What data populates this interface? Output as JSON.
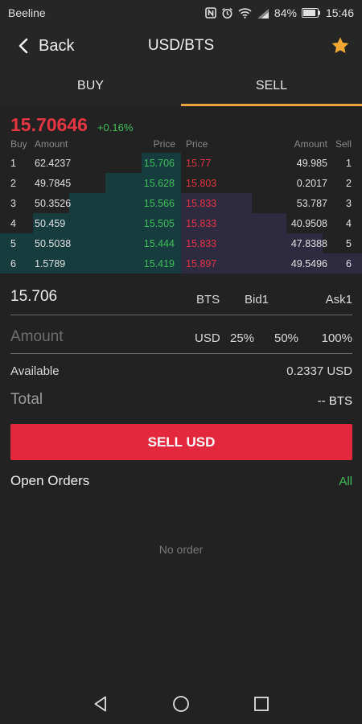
{
  "status_bar": {
    "carrier": "Beeline",
    "battery": "84%",
    "time": "15:46"
  },
  "header": {
    "back_label": "Back",
    "title": "USD/BTS",
    "icons": {
      "back": "chevron-left-icon",
      "favorite": "star-icon"
    },
    "star_color": "#f0a833"
  },
  "tabs": [
    {
      "label": "BUY",
      "active": false
    },
    {
      "label": "SELL",
      "active": true
    }
  ],
  "ticker": {
    "price": "15.70646",
    "change": "+0.16%"
  },
  "order_book": {
    "headers": {
      "buy": "Buy",
      "amount_left": "Amount",
      "price_left": "Price",
      "price_right": "Price",
      "amount_right": "Amount",
      "sell": "Sell"
    },
    "rows": [
      {
        "idx": "1",
        "bid_amount": "62.4237",
        "bid_price": "15.706",
        "ask_price": "15.77",
        "ask_amount": "49.985",
        "ask_idx": "1",
        "bid_depth": 0.22,
        "ask_depth": 0.0
      },
      {
        "idx": "2",
        "bid_amount": "49.7845",
        "bid_price": "15.628",
        "ask_price": "15.803",
        "ask_amount": "0.2017",
        "ask_idx": "2",
        "bid_depth": 0.42,
        "ask_depth": 0.0
      },
      {
        "idx": "3",
        "bid_amount": "50.3526",
        "bid_price": "15.566",
        "ask_price": "15.833",
        "ask_amount": "53.787",
        "ask_idx": "3",
        "bid_depth": 0.62,
        "ask_depth": 0.39
      },
      {
        "idx": "4",
        "bid_amount": "50.459",
        "bid_price": "15.505",
        "ask_price": "15.833",
        "ask_amount": "40.9508",
        "ask_idx": "4",
        "bid_depth": 0.82,
        "ask_depth": 0.58
      },
      {
        "idx": "5",
        "bid_amount": "50.5038",
        "bid_price": "15.444",
        "ask_price": "15.833",
        "ask_amount": "47.8388",
        "ask_idx": "5",
        "bid_depth": 1.0,
        "ask_depth": 0.78
      },
      {
        "idx": "6",
        "bid_amount": "1.5789",
        "bid_price": "15.419",
        "ask_price": "15.897",
        "ask_amount": "49.5496",
        "ask_idx": "6",
        "bid_depth": 1.0,
        "ask_depth": 1.0
      }
    ],
    "colors": {
      "bid": "#3fbf5a",
      "ask": "#e53442"
    }
  },
  "form": {
    "price_value": "15.706",
    "price_options": [
      "BTS",
      "Bid1",
      "Ask1"
    ],
    "amount_placeholder": "Amount",
    "amount_options": [
      "USD",
      "25%",
      "50%",
      "100%"
    ],
    "available_label": "Available",
    "available_value": "0.2337 USD",
    "total_label": "Total",
    "total_value": "-- BTS",
    "submit_label": "SELL USD",
    "submit_color": "#e3283d"
  },
  "open_orders": {
    "title": "Open Orders",
    "all_label": "All",
    "empty_text": "No order"
  },
  "nav_bar": {
    "icons": [
      "back-triangle-icon",
      "home-circle-icon",
      "recents-square-icon"
    ]
  }
}
